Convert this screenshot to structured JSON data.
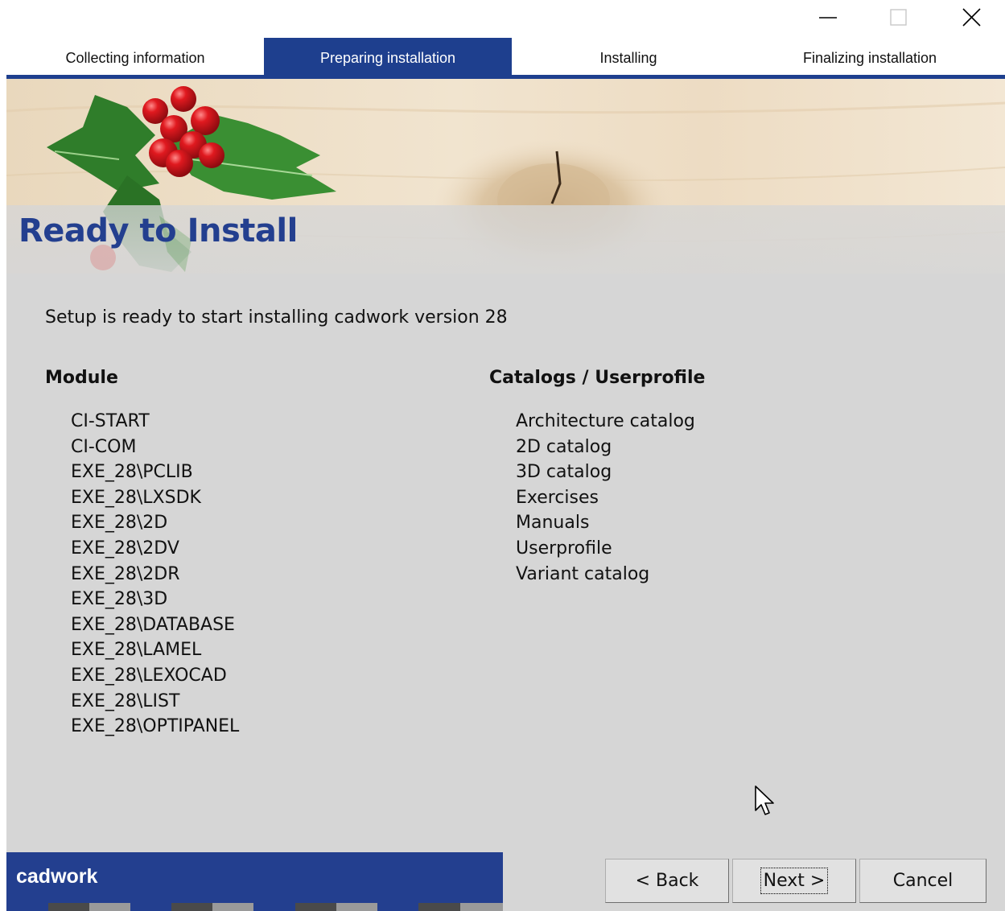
{
  "window": {
    "minimize_icon": "minimize-icon",
    "maximize_icon": "maximize-icon",
    "close_icon": "close-icon"
  },
  "tabs": [
    {
      "label": "Collecting information",
      "active": false
    },
    {
      "label": "Preparing installation",
      "active": true
    },
    {
      "label": "Installing",
      "active": false
    },
    {
      "label": "Finalizing installation",
      "active": false
    }
  ],
  "page": {
    "title": "Ready to Install",
    "intro": "Setup is ready to start installing cadwork version 28"
  },
  "modules": {
    "heading": "Module",
    "items": [
      "CI-START",
      "CI-COM",
      "EXE_28\\PCLIB",
      "EXE_28\\LXSDK",
      "EXE_28\\2D",
      "EXE_28\\2DV",
      "EXE_28\\2DR",
      "EXE_28\\3D",
      "EXE_28\\DATABASE",
      "EXE_28\\LAMEL",
      "EXE_28\\LEXOCAD",
      "EXE_28\\LIST",
      "EXE_28\\OPTIPANEL"
    ]
  },
  "catalogs": {
    "heading": "Catalogs / Userprofile",
    "items": [
      "Architecture catalog",
      "2D catalog",
      "3D catalog",
      "Exercises",
      "Manuals",
      "Userprofile",
      "Variant catalog"
    ]
  },
  "brand": {
    "name": "cadwork"
  },
  "buttons": {
    "back": "< Back",
    "next": "Next >",
    "cancel": "Cancel"
  },
  "colors": {
    "accent": "#1e3f8e",
    "content_bg": "#d6d6d6"
  }
}
